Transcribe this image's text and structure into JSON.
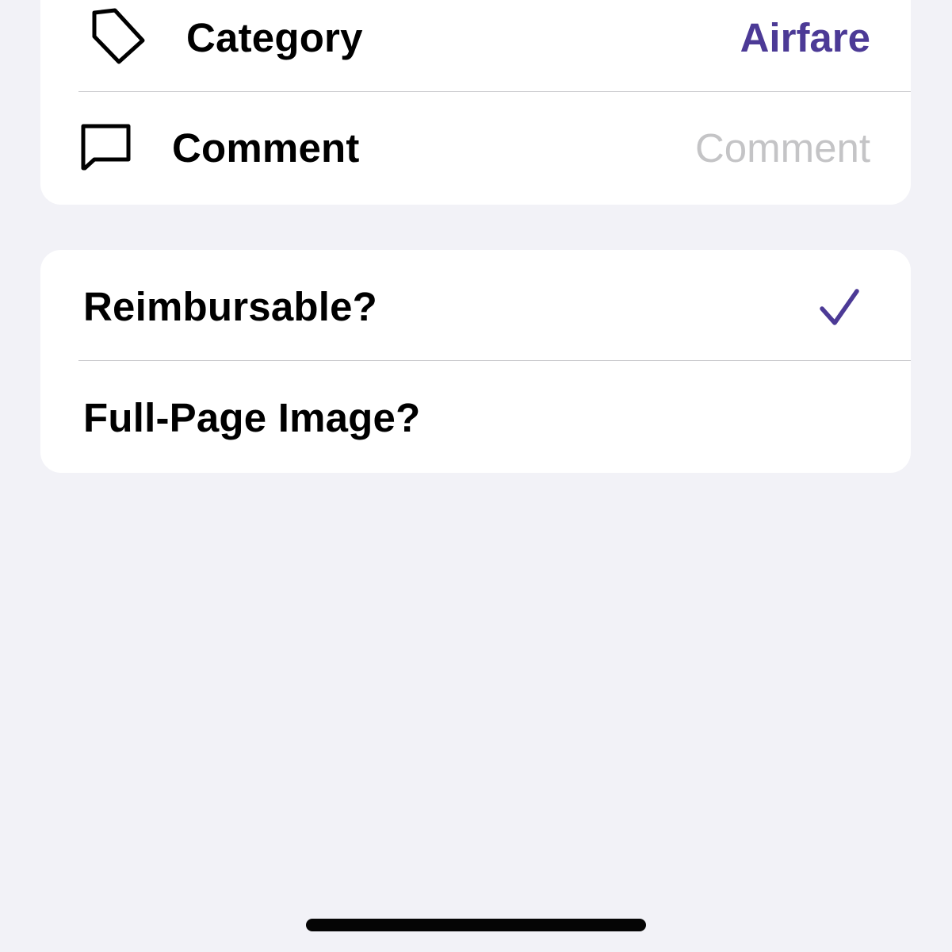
{
  "details_section": {
    "category": {
      "label": "Category",
      "value": "Airfare",
      "icon": "tag-icon"
    },
    "comment": {
      "label": "Comment",
      "placeholder": "Comment",
      "icon": "speech-bubble-icon"
    }
  },
  "options_section": {
    "reimbursable": {
      "label": "Reimbursable?",
      "checked": true
    },
    "full_page_image": {
      "label": "Full-Page Image?",
      "checked": false
    }
  },
  "colors": {
    "accent": "#4c3a96",
    "background": "#f2f2f7",
    "placeholder": "#c4c4c6"
  }
}
